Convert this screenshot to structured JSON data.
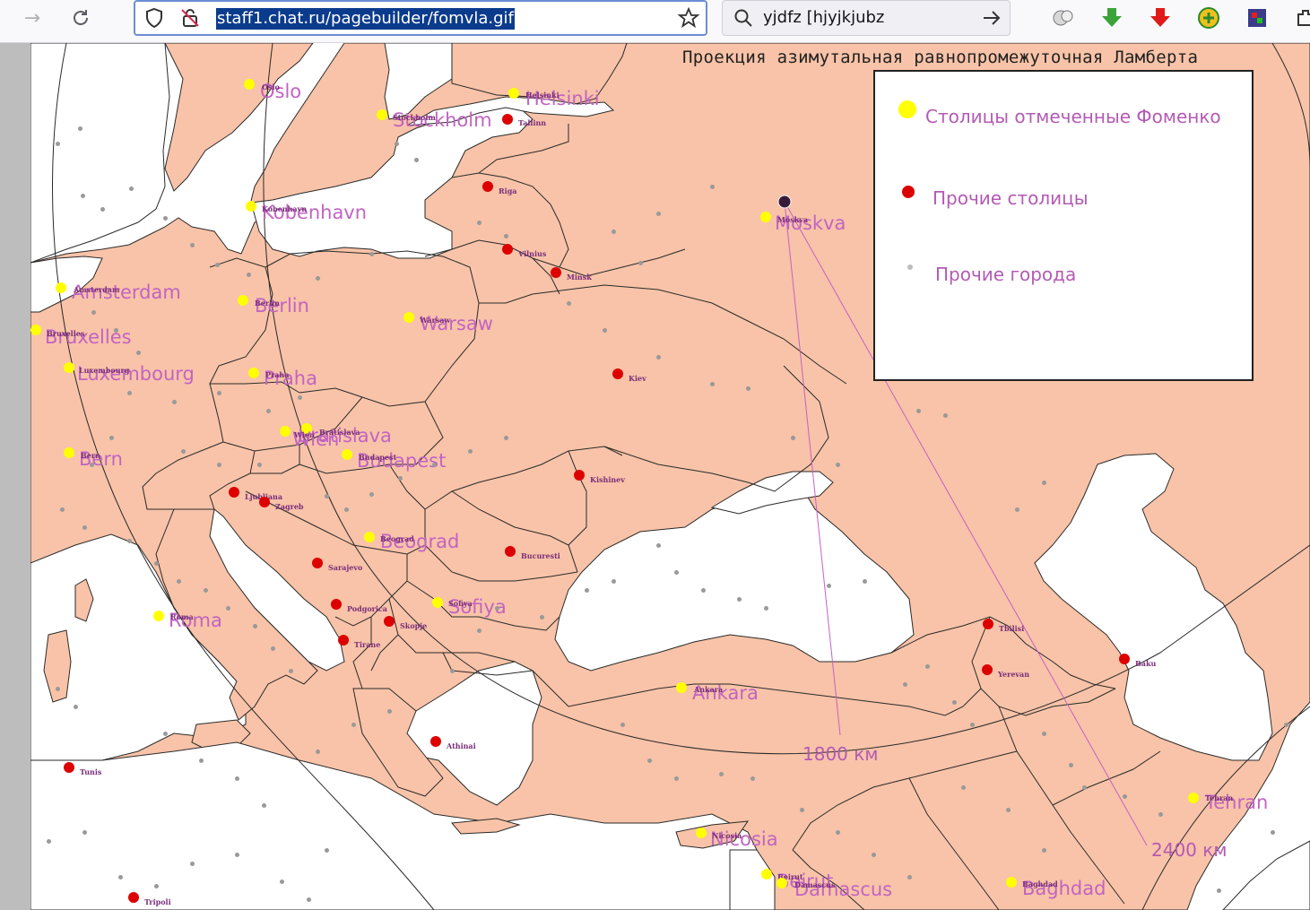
{
  "browser": {
    "url": "staff1.chat.ru/pagebuilder/fomvla.gif",
    "search_text": "yjdfz [hjyjkjubz"
  },
  "map": {
    "title": "Проекция азимутальная равнопромежуточная Ламберта",
    "land_color": "#f8c3a8",
    "sea_color": "#ffffff",
    "border_color": "#2a2a2a",
    "line_color": "#c462c4",
    "legend": {
      "fomenko_capitals": "Столицы отмеченные Фоменко",
      "other_capitals": "Прочие столицы",
      "other_cities": "Прочие города",
      "fomenko_color": "#ffff00",
      "other_capital_color": "#dd0000",
      "other_city_color": "#999999"
    },
    "distances": {
      "d1800": "1800 км",
      "d2400": "2400 км"
    },
    "fomenko_capitals": [
      {
        "id": "oslo",
        "big": "Oslo",
        "small": "Oslo"
      },
      {
        "id": "helsinki",
        "big": "Helsinki",
        "small": "Helsinki"
      },
      {
        "id": "stockholm",
        "big": "Stockholm",
        "small": "Stockholm"
      },
      {
        "id": "kobenhavn",
        "big": "Kobenhavn",
        "small": "Kobenhavn"
      },
      {
        "id": "moskva",
        "big": "Moskva",
        "small": "Moskva"
      },
      {
        "id": "amsterdam",
        "big": "Amsterdam",
        "small": "Amsterdam"
      },
      {
        "id": "berlin",
        "big": "Berlin",
        "small": "Berlin"
      },
      {
        "id": "warsaw",
        "big": "Warsaw",
        "small": "Warsaw"
      },
      {
        "id": "bruxelles",
        "big": "Bruxelles",
        "small": "Bruxelles"
      },
      {
        "id": "luxembourg",
        "big": "Luxembourg",
        "small": "Luxembourg"
      },
      {
        "id": "praha",
        "big": "Praha",
        "small": "Praha"
      },
      {
        "id": "bratislava",
        "big": "Bratislava",
        "small": "Bratislava"
      },
      {
        "id": "wien",
        "big": "Wien",
        "small": "Wien"
      },
      {
        "id": "budapest",
        "big": "Budapest",
        "small": "Budapest"
      },
      {
        "id": "bern",
        "big": "Bern",
        "small": "Bern"
      },
      {
        "id": "beograd",
        "big": "Beograd",
        "small": "Beograd"
      },
      {
        "id": "sofiya",
        "big": "Sofiya",
        "small": "Sofiya"
      },
      {
        "id": "roma",
        "big": "Roma",
        "small": "Roma"
      },
      {
        "id": "ankara",
        "big": "Ankara",
        "small": "Ankara"
      },
      {
        "id": "nicosia",
        "big": "Nicosia",
        "small": "Nicosia"
      },
      {
        "id": "beirut",
        "big": "Beirut",
        "small": "Beirut"
      },
      {
        "id": "damascus",
        "big": "Damascus",
        "small": "Damascus"
      },
      {
        "id": "baghdad",
        "big": "Baghdad",
        "small": "Baghdad"
      },
      {
        "id": "tehran",
        "big": "Tehran",
        "small": "Tehran"
      }
    ],
    "other_capitals": [
      {
        "id": "tallinn",
        "small": "Tallinn"
      },
      {
        "id": "riga",
        "small": "Riga"
      },
      {
        "id": "vilnius",
        "small": "Vilnius"
      },
      {
        "id": "minsk",
        "small": "Minsk"
      },
      {
        "id": "kiev",
        "small": "Kiev"
      },
      {
        "id": "kishinev",
        "small": "Kishinev"
      },
      {
        "id": "bucuresti",
        "small": "Bucuresti"
      },
      {
        "id": "ljubljana",
        "small": "Ljubljana"
      },
      {
        "id": "zagreb",
        "small": "Zagreb"
      },
      {
        "id": "sarajevo",
        "small": "Sarajevo"
      },
      {
        "id": "podgorica",
        "small": "Podgorica"
      },
      {
        "id": "skopje",
        "small": "Skopje"
      },
      {
        "id": "tirane",
        "small": "Tirane"
      },
      {
        "id": "athinai",
        "small": "Athinai"
      },
      {
        "id": "tbilisi",
        "small": "Tbilisi"
      },
      {
        "id": "yerevan",
        "small": "Yerevan"
      },
      {
        "id": "baku",
        "small": "Baku"
      },
      {
        "id": "tunis",
        "small": "Tunis"
      },
      {
        "id": "tripoli",
        "small": "Tripoli"
      }
    ]
  }
}
